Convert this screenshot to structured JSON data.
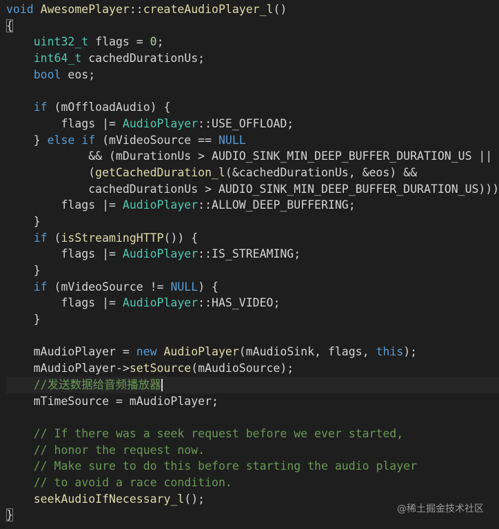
{
  "editor": {
    "lines": [
      [
        {
          "t": "void",
          "c": "kw"
        },
        {
          "t": " ",
          "c": "plain"
        },
        {
          "t": "AwesomePlayer",
          "c": "fn"
        },
        {
          "t": "::",
          "c": "plain"
        },
        {
          "t": "createAudioPlayer_l",
          "c": "fn"
        },
        {
          "t": "()",
          "c": "plain"
        }
      ],
      [
        {
          "t": "{",
          "c": "brace"
        }
      ],
      [
        {
          "t": "    ",
          "c": "plain"
        },
        {
          "t": "uint32_t",
          "c": "type"
        },
        {
          "t": " flags = ",
          "c": "plain"
        },
        {
          "t": "0",
          "c": "num"
        },
        {
          "t": ";",
          "c": "plain"
        }
      ],
      [
        {
          "t": "    ",
          "c": "plain"
        },
        {
          "t": "int64_t",
          "c": "type"
        },
        {
          "t": " cachedDurationUs;",
          "c": "plain"
        }
      ],
      [
        {
          "t": "    ",
          "c": "plain"
        },
        {
          "t": "bool",
          "c": "kw"
        },
        {
          "t": " eos;",
          "c": "plain"
        }
      ],
      [],
      [
        {
          "t": "    ",
          "c": "plain"
        },
        {
          "t": "if",
          "c": "kw"
        },
        {
          "t": " (mOffloadAudio) {",
          "c": "plain"
        }
      ],
      [
        {
          "t": "        flags |= ",
          "c": "plain"
        },
        {
          "t": "AudioPlayer",
          "c": "cls"
        },
        {
          "t": "::USE_OFFLOAD;",
          "c": "plain"
        }
      ],
      [
        {
          "t": "    } ",
          "c": "plain"
        },
        {
          "t": "else",
          "c": "kw"
        },
        {
          "t": " ",
          "c": "plain"
        },
        {
          "t": "if",
          "c": "kw"
        },
        {
          "t": " (mVideoSource == ",
          "c": "plain"
        },
        {
          "t": "NULL",
          "c": "kw"
        }
      ],
      [
        {
          "t": "            && (mDurationUs > AUDIO_SINK_MIN_DEEP_BUFFER_DURATION_US ||",
          "c": "plain"
        }
      ],
      [
        {
          "t": "            (",
          "c": "plain"
        },
        {
          "t": "getCachedDuration_l",
          "c": "fn"
        },
        {
          "t": "(&cachedDurationUs, &eos) &&",
          "c": "plain"
        }
      ],
      [
        {
          "t": "            cachedDurationUs > AUDIO_SINK_MIN_DEEP_BUFFER_DURATION_US))) {",
          "c": "plain"
        }
      ],
      [
        {
          "t": "        flags |= ",
          "c": "plain"
        },
        {
          "t": "AudioPlayer",
          "c": "cls"
        },
        {
          "t": "::ALLOW_DEEP_BUFFERING;",
          "c": "plain"
        }
      ],
      [
        {
          "t": "    }",
          "c": "plain"
        }
      ],
      [
        {
          "t": "    ",
          "c": "plain"
        },
        {
          "t": "if",
          "c": "kw"
        },
        {
          "t": " (",
          "c": "plain"
        },
        {
          "t": "isStreamingHTTP",
          "c": "fn"
        },
        {
          "t": "()) {",
          "c": "plain"
        }
      ],
      [
        {
          "t": "        flags |= ",
          "c": "plain"
        },
        {
          "t": "AudioPlayer",
          "c": "cls"
        },
        {
          "t": "::IS_STREAMING;",
          "c": "plain"
        }
      ],
      [
        {
          "t": "    }",
          "c": "plain"
        }
      ],
      [
        {
          "t": "    ",
          "c": "plain"
        },
        {
          "t": "if",
          "c": "kw"
        },
        {
          "t": " (mVideoSource != ",
          "c": "plain"
        },
        {
          "t": "NULL",
          "c": "kw"
        },
        {
          "t": ") {",
          "c": "plain"
        }
      ],
      [
        {
          "t": "        flags |= ",
          "c": "plain"
        },
        {
          "t": "AudioPlayer",
          "c": "cls"
        },
        {
          "t": "::HAS_VIDEO;",
          "c": "plain"
        }
      ],
      [
        {
          "t": "    }",
          "c": "plain"
        }
      ],
      [],
      [
        {
          "t": "    mAudioPlayer = ",
          "c": "plain"
        },
        {
          "t": "new",
          "c": "kw"
        },
        {
          "t": " ",
          "c": "plain"
        },
        {
          "t": "AudioPlayer",
          "c": "fn"
        },
        {
          "t": "(mAudioSink, flags, ",
          "c": "plain"
        },
        {
          "t": "this",
          "c": "kw"
        },
        {
          "t": ");",
          "c": "plain"
        }
      ],
      [
        {
          "t": "    mAudioPlayer->",
          "c": "plain"
        },
        {
          "t": "setSource",
          "c": "fn"
        },
        {
          "t": "(mAudioSource);",
          "c": "plain"
        }
      ],
      [
        {
          "t": "    ",
          "c": "plain"
        },
        {
          "t": "//发送数据给音频播放器",
          "c": "comment"
        },
        {
          "t": "",
          "c": "cursor"
        }
      ],
      [
        {
          "t": "    mTimeSource = mAudioPlayer;",
          "c": "plain"
        }
      ],
      [],
      [
        {
          "t": "    ",
          "c": "plain"
        },
        {
          "t": "// If there was a seek request before we ever started,",
          "c": "comment"
        }
      ],
      [
        {
          "t": "    ",
          "c": "plain"
        },
        {
          "t": "// honor the request now.",
          "c": "comment"
        }
      ],
      [
        {
          "t": "    ",
          "c": "plain"
        },
        {
          "t": "// Make sure to do this before starting the audio player",
          "c": "comment"
        }
      ],
      [
        {
          "t": "    ",
          "c": "plain"
        },
        {
          "t": "// to avoid a race condition.",
          "c": "comment"
        }
      ],
      [
        {
          "t": "    ",
          "c": "plain"
        },
        {
          "t": "seekAudioIfNecessary_l",
          "c": "fn"
        },
        {
          "t": "();",
          "c": "plain"
        }
      ],
      [
        {
          "t": "}",
          "c": "brace"
        }
      ]
    ]
  },
  "watermark": "@稀土掘金技术社区",
  "colors": {
    "background": "#1e1e1e",
    "keyword": "#569cd6",
    "function": "#dcdcaa",
    "type": "#4ec9b0",
    "number": "#b5cea8",
    "comment": "#6a9955",
    "text": "#d4d4d4"
  }
}
